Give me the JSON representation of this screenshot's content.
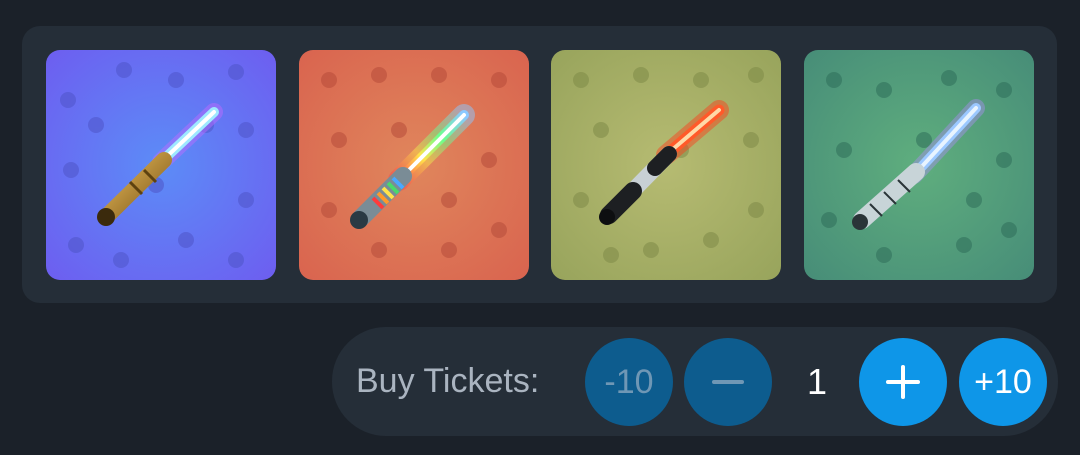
{
  "items": [
    {
      "name": "blue-lightsaber",
      "background": "#6b6ef5",
      "blade": "#9ee8ff",
      "glow": "#c36bff",
      "hilt": "#b8862e"
    },
    {
      "name": "rainbow-lightsaber",
      "background": "#df7457",
      "blade": "#ffffff",
      "glow": "#ffe36b",
      "hilt": "#7a8c96"
    },
    {
      "name": "red-lightsaber",
      "background": "#a4ae66",
      "blade": "#ff5a2a",
      "glow": "#ff3b1a",
      "hilt": "#8c9aa3"
    },
    {
      "name": "sketch-lightsaber",
      "background": "#4f9a7c",
      "blade": "#9cc8ff",
      "glow": "#b48cff",
      "hilt": "#c8d4d8"
    }
  ],
  "tickets": {
    "label": "Buy Tickets:",
    "minus10_label": "-10",
    "minus_icon": "minus-icon",
    "quantity": "1",
    "plus_icon": "plus-icon",
    "plus10_label": "+10"
  },
  "colors": {
    "page_bg": "#1b2129",
    "panel_bg": "#252e38",
    "button_disabled": "#0d5c8e",
    "button_active": "#0e96e8"
  }
}
